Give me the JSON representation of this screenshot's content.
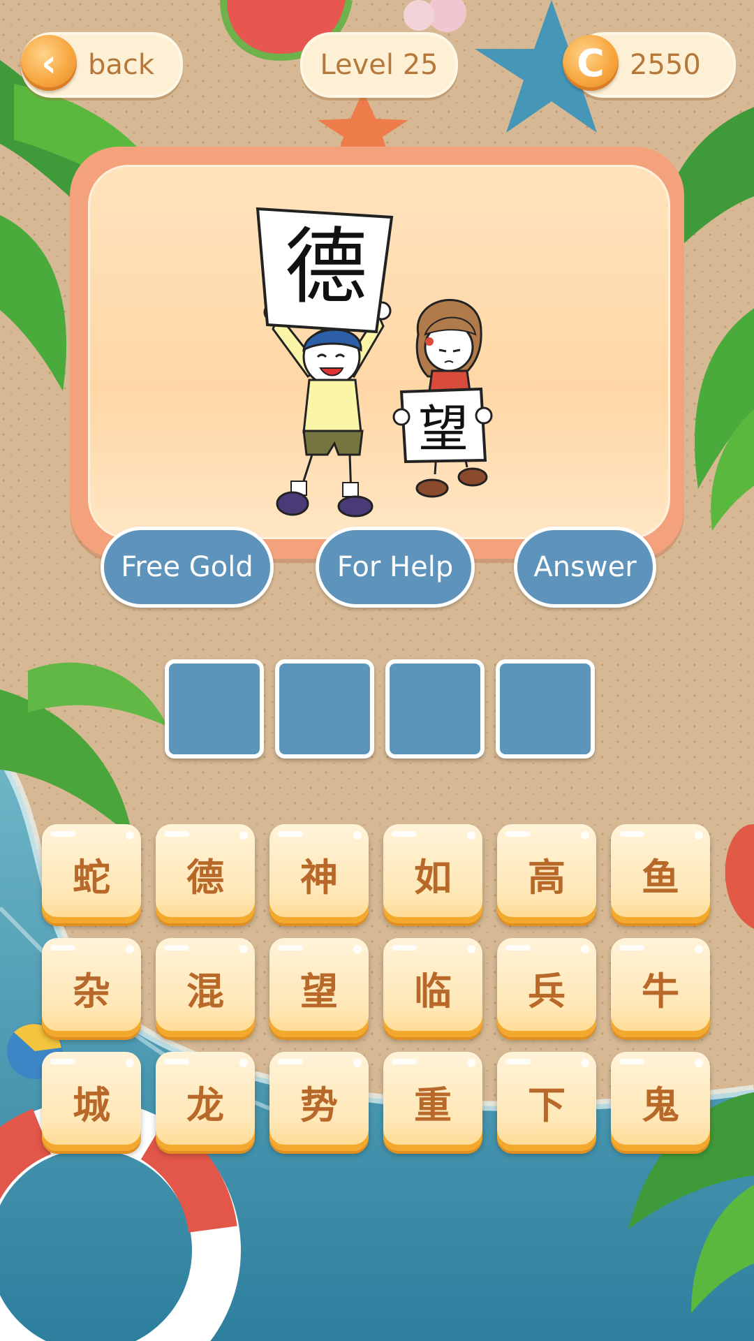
{
  "top_bar": {
    "back_label": "back",
    "level_label": "Level 25",
    "coin_value": "2550",
    "coin_symbol": "C"
  },
  "puzzle": {
    "sign_boy": "德",
    "sign_girl": "望"
  },
  "help_buttons": {
    "free_gold": "Free Gold",
    "for_help": "For Help",
    "answer": "Answer"
  },
  "answer_slots": [
    "",
    "",
    "",
    ""
  ],
  "tiles": [
    [
      "蛇",
      "德",
      "神",
      "如",
      "高",
      "鱼"
    ],
    [
      "杂",
      "混",
      "望",
      "临",
      "兵",
      "牛"
    ],
    [
      "城",
      "龙",
      "势",
      "重",
      "下",
      "鬼"
    ]
  ],
  "colors": {
    "accent_blue": "#5e93bb",
    "tile_text": "#b8692a",
    "card_border": "#f3a27c"
  }
}
